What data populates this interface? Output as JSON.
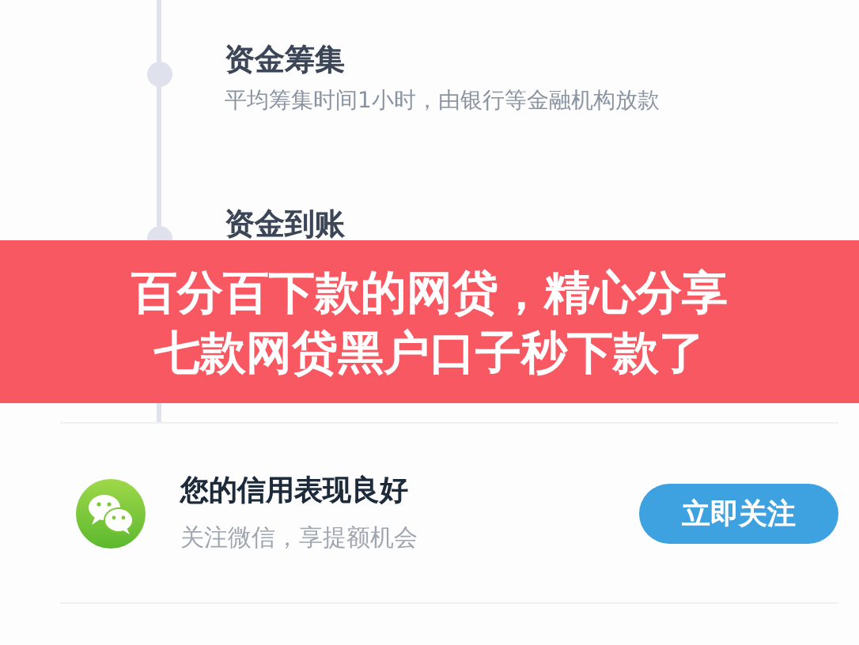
{
  "steps": [
    {
      "title": "资金筹集",
      "subtitle": "平均筹集时间1小时，由银行等金融机构放款"
    },
    {
      "title": "资金到账"
    }
  ],
  "overlay_banner": {
    "lines": [
      "百分百下款的网贷，精心分享",
      "七款网贷黑户口子秒下款了"
    ]
  },
  "promo": {
    "title": "您的信用表现良好",
    "subtitle": "关注微信，享提额机会",
    "button": "立即关注"
  }
}
